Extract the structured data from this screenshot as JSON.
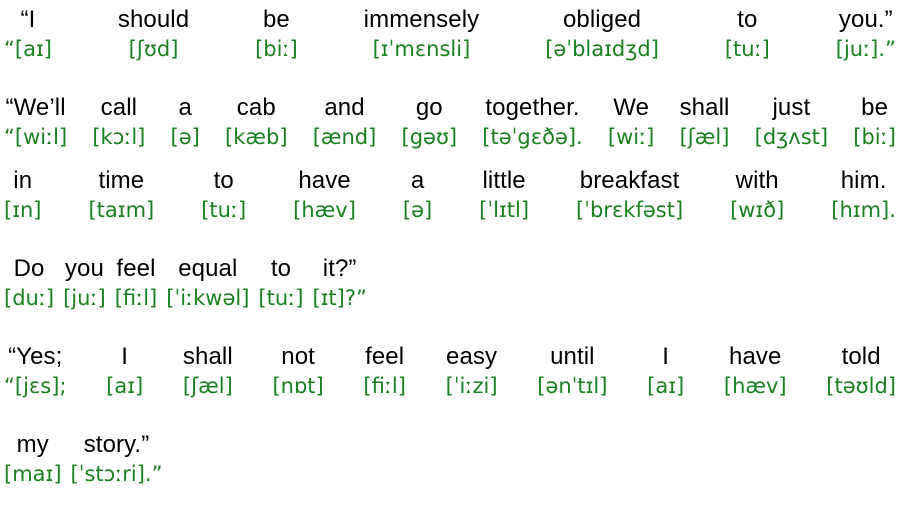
{
  "document": {
    "type": "interlinear-ipa-transcription",
    "text_color": "#000000",
    "ipa_color": "#1b8020",
    "background_color": "#ffffff"
  },
  "lines": [
    {
      "id": "line-1",
      "align": "justify",
      "pairs": [
        {
          "en": "“I",
          "ipa": "“[aɪ]"
        },
        {
          "en": "should",
          "ipa": "[ʃʊd]"
        },
        {
          "en": "be",
          "ipa": "[biː]"
        },
        {
          "en": "immensely",
          "ipa": "[ɪˈmɛnsli]"
        },
        {
          "en": "obliged",
          "ipa": "[əˈblaɪdʒd]"
        },
        {
          "en": "to",
          "ipa": "[tuː]"
        },
        {
          "en": "you.”",
          "ipa": "[juː].”"
        }
      ]
    },
    {
      "id": "line-2",
      "align": "justify",
      "pairs": [
        {
          "en": "“We’ll",
          "ipa": "“[wiːl]"
        },
        {
          "en": "call",
          "ipa": "[kɔːl]"
        },
        {
          "en": "a",
          "ipa": "[ə]"
        },
        {
          "en": "cab",
          "ipa": "[kæb]"
        },
        {
          "en": "and",
          "ipa": "[ænd]"
        },
        {
          "en": "go",
          "ipa": "[gəʊ]"
        },
        {
          "en": "together.",
          "ipa": "[təˈgɛðə]."
        },
        {
          "en": "We",
          "ipa": "[wiː]"
        },
        {
          "en": "shall",
          "ipa": "[ʃæl]"
        },
        {
          "en": "just",
          "ipa": "[dʒʌst]"
        },
        {
          "en": "be",
          "ipa": "[biː]"
        }
      ]
    },
    {
      "id": "line-3",
      "align": "justify",
      "pairs": [
        {
          "en": "in",
          "ipa": "[ɪn]"
        },
        {
          "en": "time",
          "ipa": "[taɪm]"
        },
        {
          "en": "to",
          "ipa": "[tuː]"
        },
        {
          "en": "have",
          "ipa": "[hæv]"
        },
        {
          "en": "a",
          "ipa": "[ə]"
        },
        {
          "en": "little",
          "ipa": "[ˈlɪtl]"
        },
        {
          "en": "breakfast",
          "ipa": "[ˈbrɛkfəst]"
        },
        {
          "en": "with",
          "ipa": "[wɪð]"
        },
        {
          "en": "him.",
          "ipa": "[hɪm]."
        }
      ]
    },
    {
      "id": "line-4",
      "align": "flush",
      "pairs": [
        {
          "en": "Do",
          "ipa": "[duː]"
        },
        {
          "en": "you",
          "ipa": "[juː]"
        },
        {
          "en": "feel",
          "ipa": "[fiːl]"
        },
        {
          "en": "equal",
          "ipa": "[ˈiːkwəl]"
        },
        {
          "en": "to",
          "ipa": "[tuː]"
        },
        {
          "en": "it?”",
          "ipa": "[ɪt]?”"
        }
      ]
    },
    {
      "id": "line-5",
      "align": "justify",
      "pairs": [
        {
          "en": "“Yes;",
          "ipa": "“[jɛs];"
        },
        {
          "en": "I",
          "ipa": "[aɪ]"
        },
        {
          "en": "shall",
          "ipa": "[ʃæl]"
        },
        {
          "en": "not",
          "ipa": "[nɒt]"
        },
        {
          "en": "feel",
          "ipa": "[fiːl]"
        },
        {
          "en": "easy",
          "ipa": "[ˈiːzi]"
        },
        {
          "en": "until",
          "ipa": "[ənˈtɪl]"
        },
        {
          "en": "I",
          "ipa": "[aɪ]"
        },
        {
          "en": "have",
          "ipa": "[hæv]"
        },
        {
          "en": "told",
          "ipa": "[təʊld]"
        }
      ]
    },
    {
      "id": "line-6",
      "align": "flush",
      "pairs": [
        {
          "en": "my",
          "ipa": "[maɪ]"
        },
        {
          "en": "story.”",
          "ipa": "[ˈstɔːri].”"
        }
      ]
    }
  ]
}
